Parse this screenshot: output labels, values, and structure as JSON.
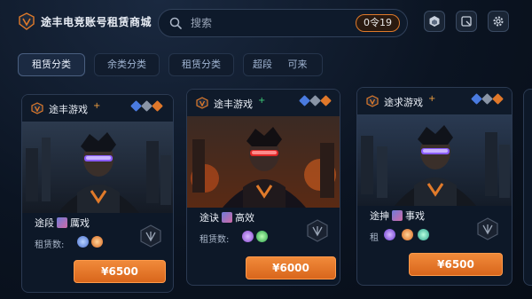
{
  "header": {
    "app_title": "途丰电竞账号租赁商城",
    "search": {
      "placeholder": "搜索",
      "right_text": "0令19"
    },
    "icons": [
      "logo-icon",
      "cube-icon",
      "screen-icon",
      "gear-icon"
    ]
  },
  "tabs": [
    {
      "label": "租赁分类",
      "active": true
    },
    {
      "label": "余类分类",
      "active": false
    },
    {
      "label": "租赁分类",
      "active": false
    },
    {
      "label": "超段",
      "active": false
    },
    {
      "label": "可来",
      "active": false
    }
  ],
  "cards": [
    {
      "game_name": "途丰游戏",
      "spark": "+",
      "spark_color": "#f0a040",
      "title_a": "途段",
      "title_b": "厲戏",
      "skins_label": "租赁数:",
      "price": "¥6500"
    },
    {
      "game_name": "途丰游戏",
      "spark": "+",
      "spark_color": "#3ed07a",
      "title_a": "途诀",
      "title_b": "高效",
      "skins_label": "租赁数:",
      "price": "¥6000"
    },
    {
      "game_name": "途求游戏",
      "spark": "+",
      "spark_color": "#f0a040",
      "title_a": "途抻",
      "title_b": "事戏",
      "skins_label": "租",
      "price": "¥6500"
    }
  ],
  "colors": {
    "accent": "#e07a2a",
    "background": "#0b1422",
    "badge_blue": "#4a7be0",
    "badge_grey": "#8a95a6",
    "badge_orange": "#e0782a"
  }
}
